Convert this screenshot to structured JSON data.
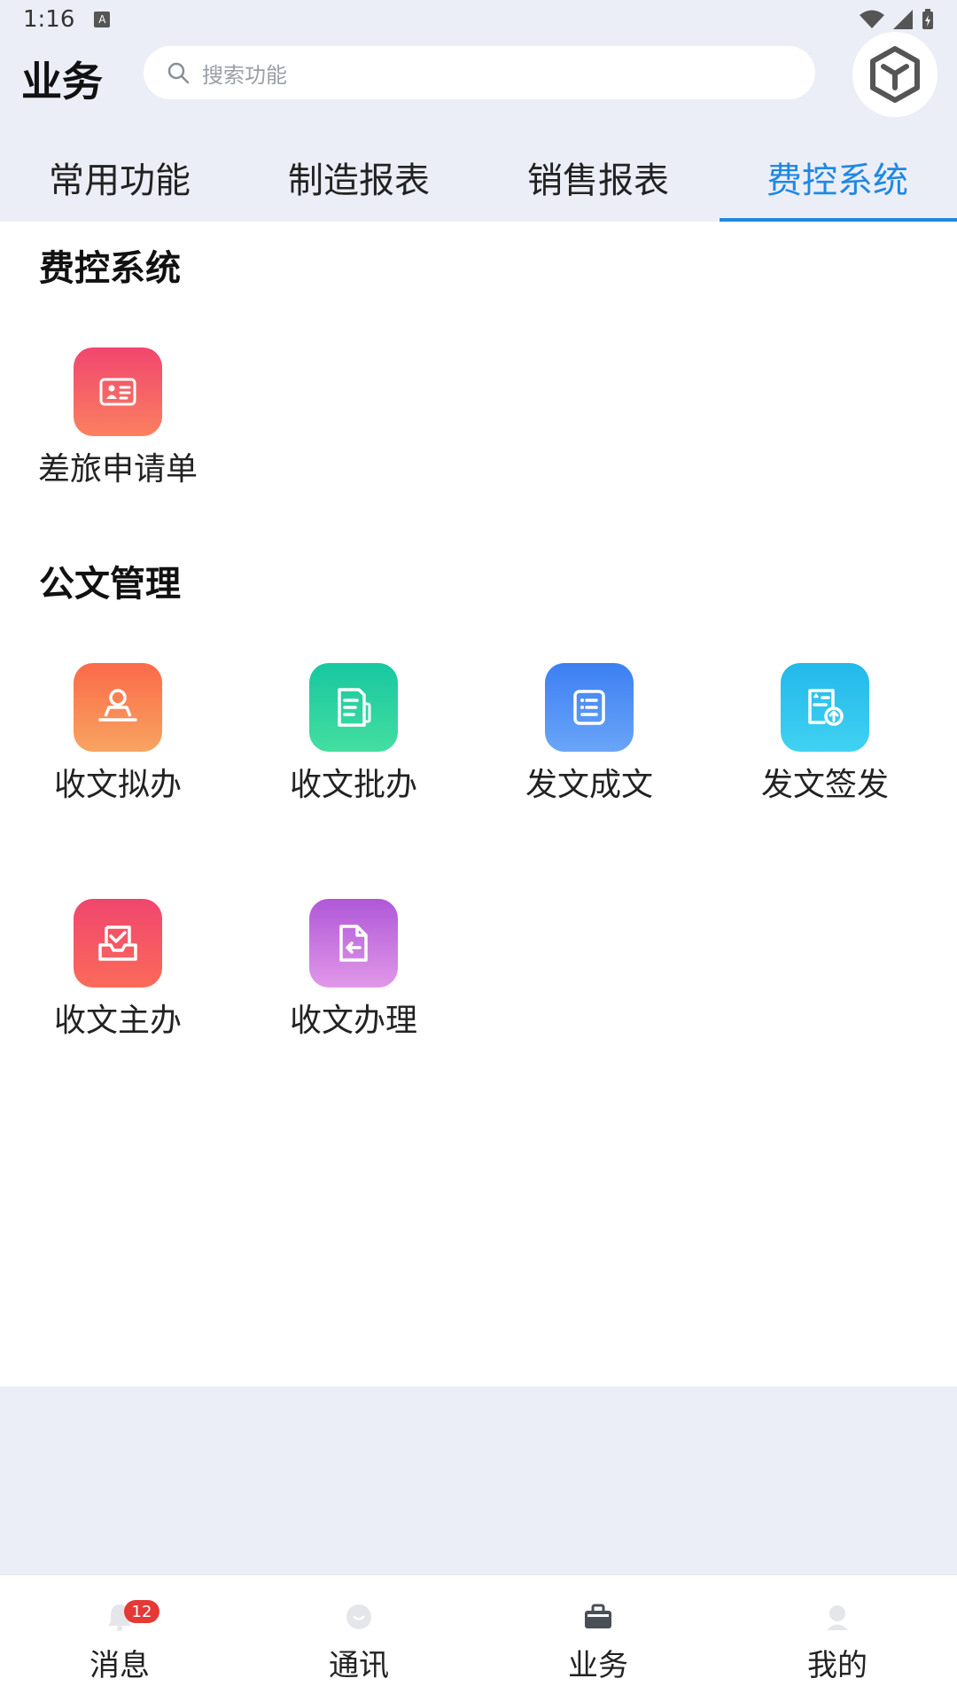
{
  "status_bar": {
    "time": "1:16",
    "indicator": "A"
  },
  "header": {
    "title": "业务",
    "search_placeholder": "搜索功能",
    "cube_icon": "cube-icon"
  },
  "tabs": [
    {
      "label": "常用功能",
      "active": false
    },
    {
      "label": "制造报表",
      "active": false
    },
    {
      "label": "销售报表",
      "active": false
    },
    {
      "label": "费控系统",
      "active": true
    }
  ],
  "sections": [
    {
      "title": "费控系统",
      "items": [
        {
          "label": "差旅申请单",
          "icon": "id-card-icon",
          "color_from": "#f0466e",
          "color_to": "#fb8060"
        }
      ]
    },
    {
      "title": "公文管理",
      "items": [
        {
          "label": "收文拟办",
          "icon": "user-desk-icon",
          "color_from": "#fb6a4a",
          "color_to": "#f8a460"
        },
        {
          "label": "收文批办",
          "icon": "doc-pen-icon",
          "color_from": "#17c7a0",
          "color_to": "#44dea0"
        },
        {
          "label": "发文成文",
          "icon": "doc-list-icon",
          "color_from": "#3c7ff2",
          "color_to": "#6aa5f8"
        },
        {
          "label": "发文签发",
          "icon": "doc-upload-icon",
          "color_from": "#22b8ea",
          "color_to": "#40d2f2"
        },
        {
          "label": "收文主办",
          "icon": "inbox-check-icon",
          "color_from": "#f0466e",
          "color_to": "#fb6a5a"
        },
        {
          "label": "收文办理",
          "icon": "doc-return-icon",
          "color_from": "#b057d8",
          "color_to": "#e098e8"
        }
      ]
    }
  ],
  "bottom_nav": [
    {
      "label": "消息",
      "icon": "bell-icon",
      "badge": "12"
    },
    {
      "label": "通讯",
      "icon": "chat-icon"
    },
    {
      "label": "业务",
      "icon": "briefcase-icon",
      "active": true
    },
    {
      "label": "我的",
      "icon": "person-icon"
    }
  ]
}
